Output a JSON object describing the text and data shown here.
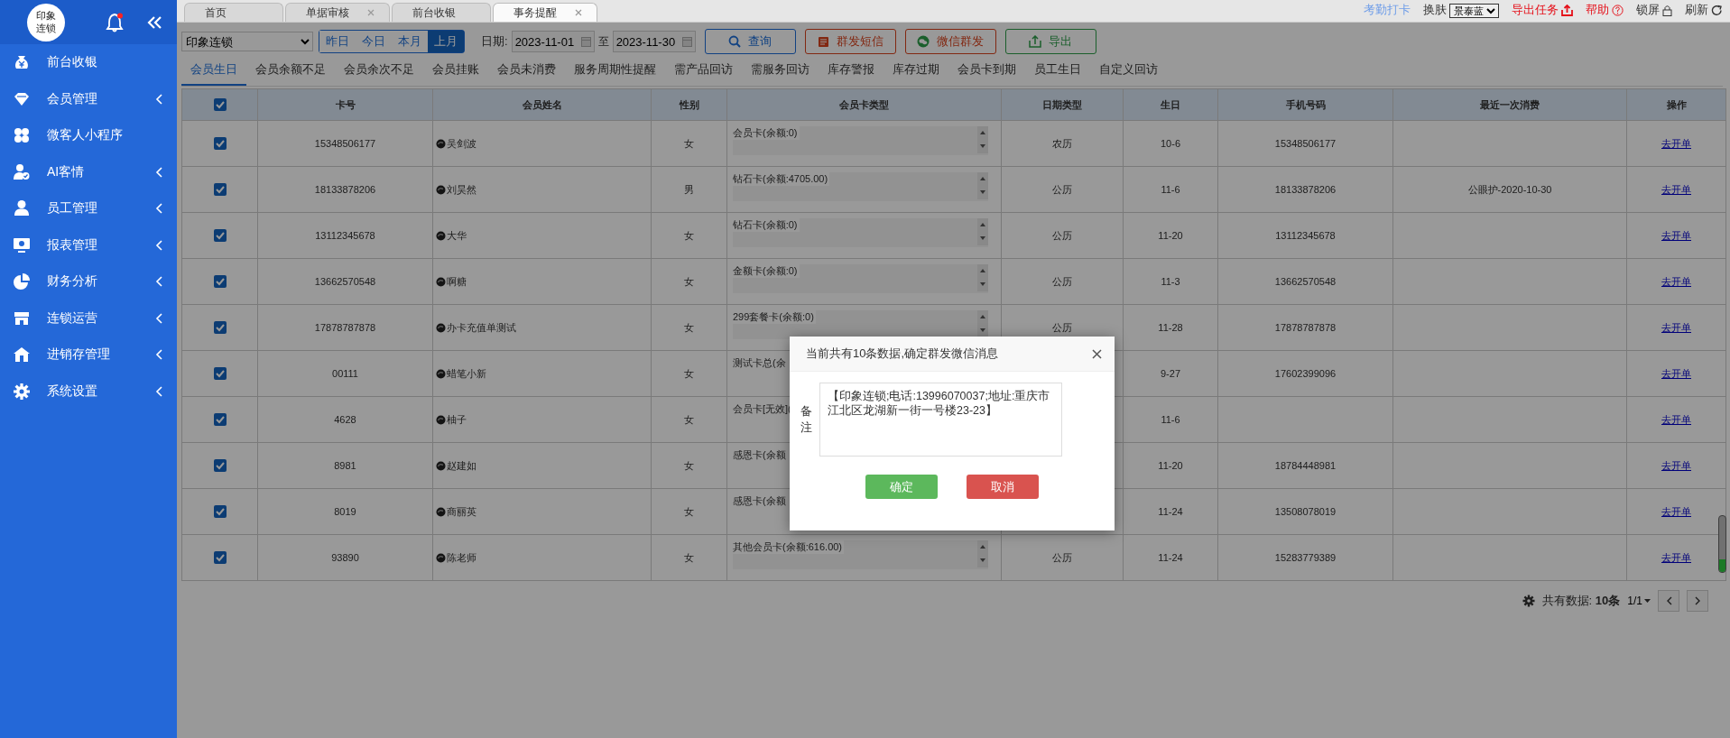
{
  "sidebar": {
    "logo": "印象连锁",
    "unread": true,
    "items": [
      {
        "label": "前台收银",
        "expandable": false
      },
      {
        "label": "会员管理",
        "expandable": true
      },
      {
        "label": "微客人小程序",
        "expandable": false
      },
      {
        "label": "AI客情",
        "expandable": true
      },
      {
        "label": "员工管理",
        "expandable": true
      },
      {
        "label": "报表管理",
        "expandable": true
      },
      {
        "label": "财务分析",
        "expandable": true
      },
      {
        "label": "连锁运营",
        "expandable": true
      },
      {
        "label": "进销存管理",
        "expandable": true
      },
      {
        "label": "系统设置",
        "expandable": true
      }
    ]
  },
  "tabs": [
    {
      "label": "首页",
      "closable": false,
      "selected": false
    },
    {
      "label": "单据审核",
      "closable": true,
      "selected": false
    },
    {
      "label": "前台收银",
      "closable": false,
      "selected": false
    },
    {
      "label": "事务提醒",
      "closable": true,
      "selected": true
    }
  ],
  "top_tools": [
    {
      "kind": "link",
      "label": "考勤打卡"
    },
    {
      "kind": "skin",
      "label": "换肤",
      "value": "景泰蓝"
    },
    {
      "kind": "export",
      "label": "导出任务"
    },
    {
      "kind": "help",
      "label": "帮助"
    },
    {
      "kind": "lock",
      "label": "锁屏"
    },
    {
      "kind": "refresh",
      "label": "刷新"
    }
  ],
  "toolbar": {
    "store": "印象连锁",
    "periods": [
      {
        "label": "昨日",
        "selected": false
      },
      {
        "label": "今日",
        "selected": false
      },
      {
        "label": "本月",
        "selected": false
      },
      {
        "label": "上月",
        "selected": true
      }
    ],
    "date_label": "日期:",
    "date_from": "2023-11-01",
    "date_sep": "至",
    "date_to": "2023-11-30",
    "buttons": [
      {
        "kind": "search",
        "label": "查询"
      },
      {
        "kind": "sms",
        "label": "群发短信"
      },
      {
        "kind": "wechat",
        "label": "微信群发"
      },
      {
        "kind": "export",
        "label": "导出"
      }
    ]
  },
  "subtabs": [
    {
      "label": "会员生日",
      "selected": true
    },
    {
      "label": "会员余额不足",
      "selected": false
    },
    {
      "label": "会员余次不足",
      "selected": false
    },
    {
      "label": "会员挂账",
      "selected": false
    },
    {
      "label": "会员未消费",
      "selected": false
    },
    {
      "label": "服务周期性提醒",
      "selected": false
    },
    {
      "label": "需产品回访",
      "selected": false
    },
    {
      "label": "需服务回访",
      "selected": false
    },
    {
      "label": "库存警报",
      "selected": false
    },
    {
      "label": "库存过期",
      "selected": false
    },
    {
      "label": "会员卡到期",
      "selected": false
    },
    {
      "label": "员工生日",
      "selected": false
    },
    {
      "label": "自定义回访",
      "selected": false
    }
  ],
  "table": {
    "all_checked": true,
    "columns": [
      "卡号",
      "会员姓名",
      "性别",
      "会员卡类型",
      "日期类型",
      "生日",
      "手机号码",
      "最近一次消费",
      "操作"
    ],
    "rows": [
      {
        "checked": true,
        "card_no": "15348506177",
        "name": "吴剑波",
        "gender": "女",
        "card_type": "会员卡(余额:0)",
        "scroll_arrows": true,
        "date_type": "农历",
        "birthday": "10-6",
        "phone": "15348506177",
        "action": "去开单"
      },
      {
        "checked": true,
        "card_no": "18133878206",
        "name": "刘昊然",
        "gender": "男",
        "card_type": "钻石卡(余额:4705.00)",
        "scroll_arrows": true,
        "date_type": "公历",
        "birthday": "11-6",
        "phone": "18133878206",
        "last_purchase": "公眼护-2020-10-30",
        "action": "去开单"
      },
      {
        "checked": true,
        "card_no": "13112345678",
        "name": "大华",
        "gender": "女",
        "card_type": "钻石卡(余额:0)",
        "scroll_arrows": true,
        "date_type": "公历",
        "birthday": "11-20",
        "phone": "13112345678",
        "action": "去开单"
      },
      {
        "checked": true,
        "card_no": "13662570548",
        "name": "啊糖",
        "gender": "女",
        "card_type": "金额卡(余额:0)",
        "scroll_arrows": true,
        "date_type": "公历",
        "birthday": "11-3",
        "phone": "13662570548",
        "action": "去开单"
      },
      {
        "checked": true,
        "card_no": "17878787878",
        "name": "办卡充值单测试",
        "gender": "女",
        "card_type": "299套餐卡(余额:0)",
        "scroll_arrows": true,
        "date_type": "公历",
        "birthday": "11-28",
        "phone": "17878787878",
        "action": "去开单"
      },
      {
        "checked": true,
        "card_no": "00111",
        "name": "蜡笔小新",
        "gender": "女",
        "card_type": "测试卡总(余",
        "scroll_arrows": false,
        "birthday": "9-27",
        "phone": "17602399096",
        "action": "去开单"
      },
      {
        "checked": true,
        "card_no": "4628",
        "name": "柚子",
        "gender": "女",
        "card_type": "会员卡[无效](",
        "scroll_arrows": false,
        "birthday": "11-6",
        "action": "去开单"
      },
      {
        "checked": true,
        "card_no": "8981",
        "name": "赵建如",
        "gender": "女",
        "card_type": "感恩卡(余额",
        "scroll_arrows": false,
        "birthday": "11-20",
        "phone": "18784448981",
        "action": "去开单"
      },
      {
        "checked": true,
        "card_no": "8019",
        "name": "商丽英",
        "gender": "女",
        "card_type": "感恩卡(余额",
        "scroll_arrows": false,
        "birthday": "11-24",
        "phone": "13508078019",
        "action": "去开单"
      },
      {
        "checked": true,
        "card_no": "93890",
        "name": "陈老师",
        "gender": "女",
        "card_type": "其他会员卡(余额:616.00)",
        "scroll_arrows": true,
        "date_type": "公历",
        "birthday": "11-24",
        "phone": "15283779389",
        "action": "去开单"
      }
    ]
  },
  "pager": {
    "total": "共有数据: **10条**",
    "page": "1/1"
  },
  "dialog": {
    "title": "当前共有10条数据,确定群发微信消息",
    "note_label": "备注",
    "note": "【印象连锁;电话:13996070037;地址:重庆市江北区龙湖新一街一号楼23-23】",
    "confirm": "确定",
    "cancel": "取消"
  }
}
